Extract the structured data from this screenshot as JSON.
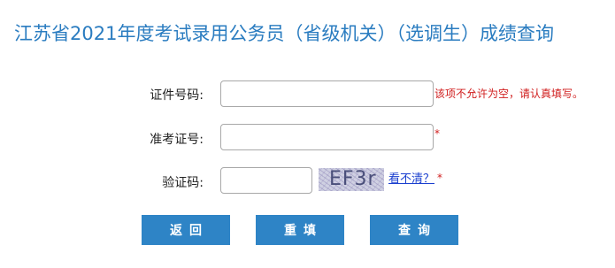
{
  "page": {
    "title": "江苏省2021年度考试录用公务员（省级机关）（选调生）成绩查询"
  },
  "form": {
    "id_number": {
      "label": "证件号码:",
      "value": "",
      "error": "该项不允许为空，请认真填写。"
    },
    "exam_number": {
      "label": "准考证号:",
      "value": "",
      "required_mark": "*"
    },
    "captcha": {
      "label": "验证码:",
      "value": "",
      "image_text": "EF3r",
      "refresh_link": "看不清？",
      "required_mark": "*"
    }
  },
  "buttons": {
    "back": "返回",
    "reset": "重填",
    "query": "查询"
  }
}
